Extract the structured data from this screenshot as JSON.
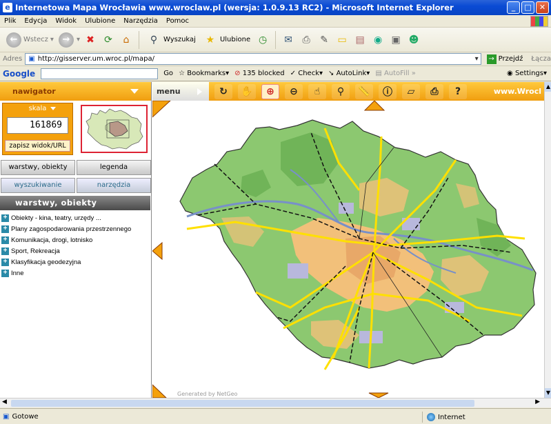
{
  "window": {
    "title": "Internetowa Mapa Wrocławia www.wroclaw.pl (wersja: 1.0.9.13 RC2) - Microsoft Internet Explorer",
    "min": "_",
    "max": "□",
    "close": "✕"
  },
  "menu": [
    "Plik",
    "Edycja",
    "Widok",
    "Ulubione",
    "Narzędzia",
    "Pomoc"
  ],
  "toolbar": {
    "back": "Wstecz",
    "search": "Wyszukaj",
    "favorites": "Ulubione"
  },
  "address": {
    "label": "Adres",
    "url": "http://gisserver.um.wroc.pl/mapa/",
    "go": "Przejdź",
    "links": "Łącza"
  },
  "google": {
    "logo": "Google",
    "go": "Go",
    "bookmarks": "Bookmarks",
    "blocked": "135 blocked",
    "check": "Check",
    "autolink": "AutoLink",
    "autofill": "AutoFill",
    "settings": "Settings"
  },
  "navigator": {
    "header": "nawigator",
    "scale_label": "skala",
    "scale_value": "161869",
    "save_view": "zapisz widok/URL"
  },
  "tabs": {
    "layers": "warstwy, obiekty",
    "legend": "legenda",
    "search": "wyszukiwanie",
    "tools": "narzędzia"
  },
  "layers": {
    "header": "warstwy, obiekty",
    "items": [
      "Obiekty - kina, teatry, urzędy ...",
      "Plany zagospodarowania przestrzennego",
      "Komunikacja, drogi, lotnisko",
      "Sport, Rekreacja",
      "Klasyfikacja geodezyjna",
      "Inne"
    ]
  },
  "map_toolbar": {
    "menu": "menu",
    "site": "www.Wrocl"
  },
  "status": {
    "text": "Gotowe",
    "zone": "Internet"
  },
  "colors": {
    "nav_orange": "#f4a10c",
    "map_green": "#8cc870",
    "urban_orange": "#f2c07a",
    "road_yellow": "#ffe000",
    "river_blue": "#7890c8"
  }
}
